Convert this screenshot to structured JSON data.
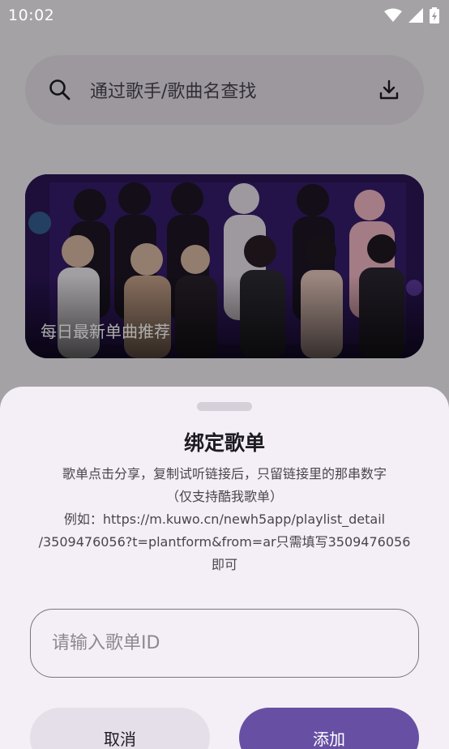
{
  "status_bar": {
    "time": "10:02",
    "icons": [
      "wifi-icon",
      "signal-icon",
      "battery-charging-icon"
    ]
  },
  "search": {
    "placeholder": "通过歌手/歌曲名查找",
    "icon": "search-icon",
    "action_icon": "download-icon"
  },
  "banner": {
    "caption": "每日最新单曲推荐"
  },
  "dialog": {
    "title": "绑定歌单",
    "description_lines": [
      "歌单点击分享，复制试听链接后，只留链接里的那串数字",
      "（仅支持酷我歌单）",
      "例如：https://m.kuwo.cn/newh5app/playlist_detail",
      "/3509476056?t=plantform&from=ar只需填写3509476056",
      "即可"
    ],
    "input_placeholder": "请输入歌单ID",
    "input_value": "",
    "cancel_label": "取消",
    "add_label": "添加"
  },
  "colors": {
    "accent": "#6750a4",
    "scrim": "rgba(0,0,0,0.32)"
  }
}
